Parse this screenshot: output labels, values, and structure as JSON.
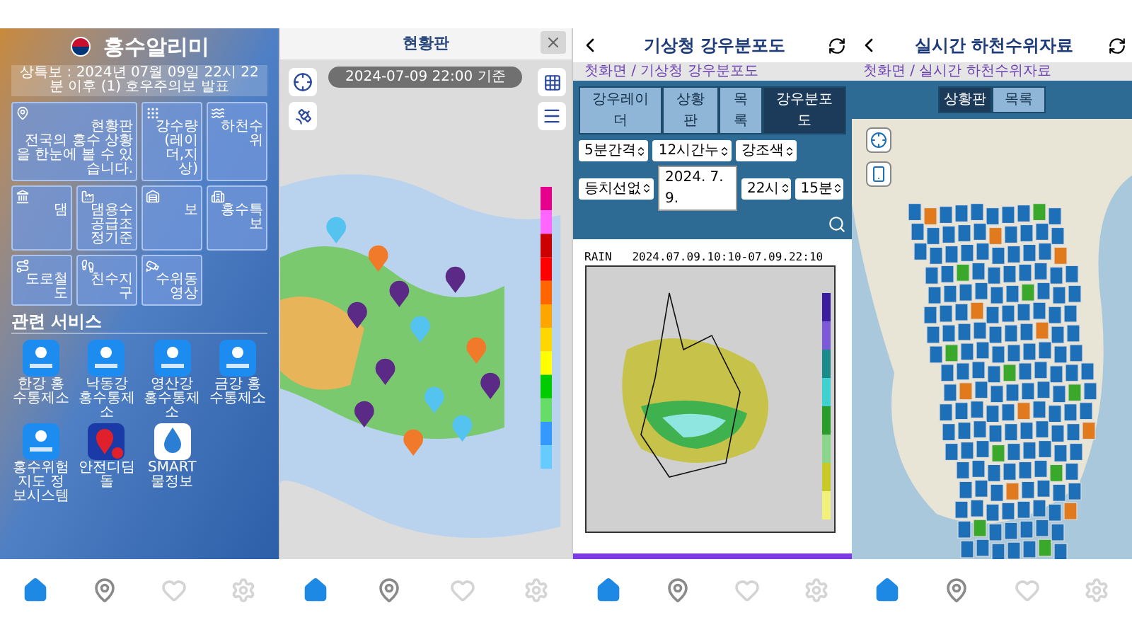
{
  "home": {
    "title": "홍수알리미",
    "ticker": "상특보 : 2024년 07월 09일 22시 22분 이후 (1) 호우주의보 발표",
    "tiles": [
      {
        "kind": "pin",
        "label": "현황판",
        "subtitle": "전국의 홍수 상황을 한눈에 볼 수 있습니다.",
        "wide": true
      },
      {
        "kind": "dots",
        "label": "강수량",
        "subtitle": "(레이더,지상)",
        "wide": false
      },
      {
        "kind": "wave",
        "label": "하천수위",
        "wide": false
      },
      {
        "kind": "dam",
        "label": "댐",
        "wide": false
      },
      {
        "kind": "supply",
        "label": "댐용수 공급조정기준",
        "wide": false
      },
      {
        "kind": "weir",
        "label": "보",
        "wide": false
      },
      {
        "kind": "building",
        "label": "홍수특보",
        "wide": false
      },
      {
        "kind": "road",
        "label": "도로철도",
        "wide": false
      },
      {
        "kind": "walk",
        "label": "친수지구",
        "wide": false
      },
      {
        "kind": "camera",
        "label": "수위동영상",
        "wide": false
      }
    ],
    "services_title": "관련 서비스",
    "services": [
      {
        "kind": "agency",
        "label": "한강 홍수통제소"
      },
      {
        "kind": "agency",
        "label": "낙동강 홍수통제소"
      },
      {
        "kind": "agency",
        "label": "영산강 홍수통제소"
      },
      {
        "kind": "agency",
        "label": "금강 홍수통제소"
      },
      {
        "kind": "agency",
        "label": "홍수위험지도 정보시스템"
      },
      {
        "kind": "safety",
        "label": "안전디딤돌"
      },
      {
        "kind": "water",
        "label": "SMART 물정보"
      }
    ]
  },
  "dashboard": {
    "title": "현황판",
    "timestamp": "2024-07-09 22:00 기준"
  },
  "rainfall": {
    "title": "기상청 강우분포도",
    "breadcrumb": "첫화면 / 기상청 강우분포도",
    "tabs": [
      {
        "label": "강우레이더",
        "selected": false
      },
      {
        "label": "상황판",
        "selected": false
      },
      {
        "label": "목록",
        "selected": false
      },
      {
        "label": "강우분포도",
        "selected": true
      }
    ],
    "selects": [
      "5분간격",
      "12시간누",
      "강조색",
      "등치선없"
    ],
    "date": "2024. 7. 9.",
    "hour": "22시",
    "minute": "15분",
    "chart_caption": "RAIN   2024.07.09.10:10-07.09.22:10"
  },
  "river": {
    "title": "실시간 하천수위자료",
    "breadcrumb": "첫화면 / 실시간 하천수위자료",
    "tabs": [
      {
        "label": "상황판",
        "selected": true
      },
      {
        "label": "목록",
        "selected": false
      }
    ]
  },
  "bottom_navs": [
    {
      "items": [
        {
          "kind": "home",
          "selected": true
        },
        {
          "kind": "map",
          "selected": false
        },
        {
          "kind": "favorite",
          "selected": false
        },
        {
          "kind": "settings",
          "selected": false
        }
      ]
    },
    {
      "items": [
        {
          "kind": "home",
          "selected": true
        },
        {
          "kind": "map",
          "selected": false
        },
        {
          "kind": "favorite",
          "selected": false
        },
        {
          "kind": "settings",
          "selected": false
        }
      ]
    },
    {
      "items": [
        {
          "kind": "home",
          "selected": true
        },
        {
          "kind": "map",
          "selected": false
        },
        {
          "kind": "favorite",
          "selected": false
        },
        {
          "kind": "settings",
          "selected": false
        }
      ]
    },
    {
      "items": [
        {
          "kind": "home",
          "selected": true
        },
        {
          "kind": "map",
          "selected": false
        },
        {
          "kind": "favorite",
          "selected": false
        },
        {
          "kind": "settings",
          "selected": false
        }
      ]
    }
  ]
}
